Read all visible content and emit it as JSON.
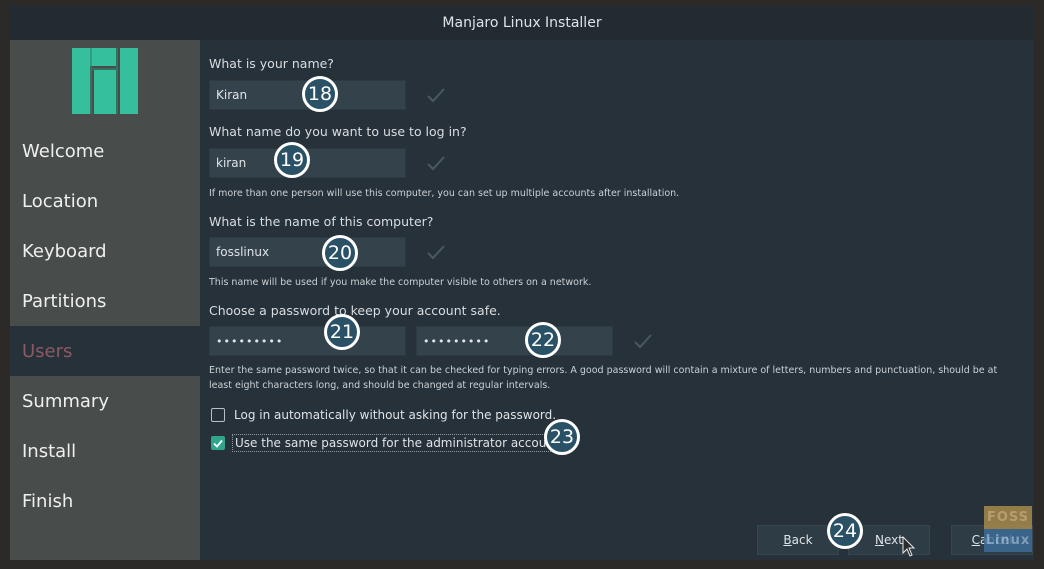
{
  "window": {
    "title": "Manjaro Linux Installer"
  },
  "colors": {
    "brand_green": "#35bf9c",
    "active_nav": "#8c5a63",
    "checkbox_checked": "#2fa58a",
    "marker_fill": "#2a5166"
  },
  "sidebar": {
    "logo_icon": "manjaro-logo",
    "items": [
      {
        "label": "Welcome",
        "active": false
      },
      {
        "label": "Location",
        "active": false
      },
      {
        "label": "Keyboard",
        "active": false
      },
      {
        "label": "Partitions",
        "active": false
      },
      {
        "label": "Users",
        "active": true
      },
      {
        "label": "Summary",
        "active": false
      },
      {
        "label": "Install",
        "active": false
      },
      {
        "label": "Finish",
        "active": false
      }
    ]
  },
  "form": {
    "name": {
      "label": "What is your name?",
      "value": "Kiran",
      "valid_icon": "checkmark-icon"
    },
    "login": {
      "label": "What name do you want to use to log in?",
      "value": "kiran",
      "hint": "If more than one person will use this computer, you can set up multiple accounts after installation.",
      "valid_icon": "checkmark-icon"
    },
    "hostname": {
      "label": "What is the name of this computer?",
      "value": "fosslinux",
      "hint": "This name will be used if you make the computer visible to others on a network.",
      "valid_icon": "checkmark-icon"
    },
    "password": {
      "label": "Choose a password to keep your account safe.",
      "value": "•••••••••",
      "confirm_value": "•••••••••",
      "hint_line1": "Enter the same password twice, so that it can be checked for typing errors. A good password will contain a mixture of letters, numbers and punctuation, should be at",
      "hint_line2": "least eight characters long, and should be changed at regular intervals.",
      "valid_icon": "checkmark-icon"
    },
    "autologin": {
      "label": "Log in automatically without asking for the password.",
      "checked": false
    },
    "same_admin_password": {
      "label": "Use the same password for the administrator account.",
      "checked": true
    }
  },
  "markers": [
    "18",
    "19",
    "20",
    "21",
    "22",
    "23",
    "24"
  ],
  "buttons": {
    "back": {
      "mnemonic": "B",
      "rest": "ack"
    },
    "next": {
      "mnemonic": "N",
      "rest": "ext"
    },
    "cancel": {
      "mnemonic": "C",
      "rest": "ancel"
    }
  },
  "watermark": {
    "top": "FOSS",
    "bottom": "Linux"
  }
}
